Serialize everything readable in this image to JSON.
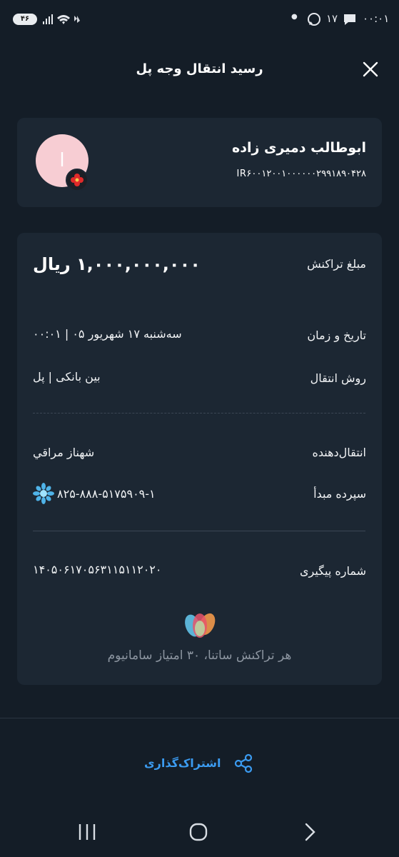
{
  "status_bar": {
    "pill": "۴۶",
    "notif_count": "۱۷",
    "time": "۰۰:۰۱"
  },
  "header": {
    "title": "رسید انتقال وجه پل"
  },
  "recipient": {
    "name": "ابوطالب دمیری زاده",
    "iban": "IR۶۰۰۱۲۰۰۱۰۰۰۰۰۰۲۹۹۱۸۹۰۴۲۸",
    "avatar_letter": "ا"
  },
  "details": {
    "amount_label": "مبلغ تراکنش",
    "amount_value": "۱,۰۰۰,۰۰۰,۰۰۰ ریال",
    "datetime_label": "تاریخ و زمان",
    "datetime_value": "سه‌شنبه ۱۷ شهریور ۰۵ | ۰۰:۰۱",
    "method_label": "روش انتقال",
    "method_value": "بین بانکی | پل",
    "sender_label": "انتقال‌دهنده",
    "sender_value": "شهناز مراقي",
    "source_label": "سپرده مبدأ",
    "source_value": "۸۲۵-۸۸۸-۵۱۷۵۹۰۹-۱",
    "tracking_label": "شماره پیگیری",
    "tracking_value": "۱۴۰۵۰۶۱۷۰۵۶۳۱۱۵۱۱۲۰۲۰"
  },
  "promo": {
    "text": "هر تراکنش ساتنا، ۳۰ امتیاز سامانیوم"
  },
  "footer": {
    "share_label": "اشتراک‌گذاری"
  },
  "colors": {
    "background": "#141d27",
    "card": "#1c2733",
    "accent": "#3b9bf0",
    "muted": "#8d96a1"
  },
  "icons": [
    "close-icon",
    "share-icon",
    "flower-badge-icon",
    "snowflake-logo-icon",
    "samanium-logo-icon"
  ]
}
